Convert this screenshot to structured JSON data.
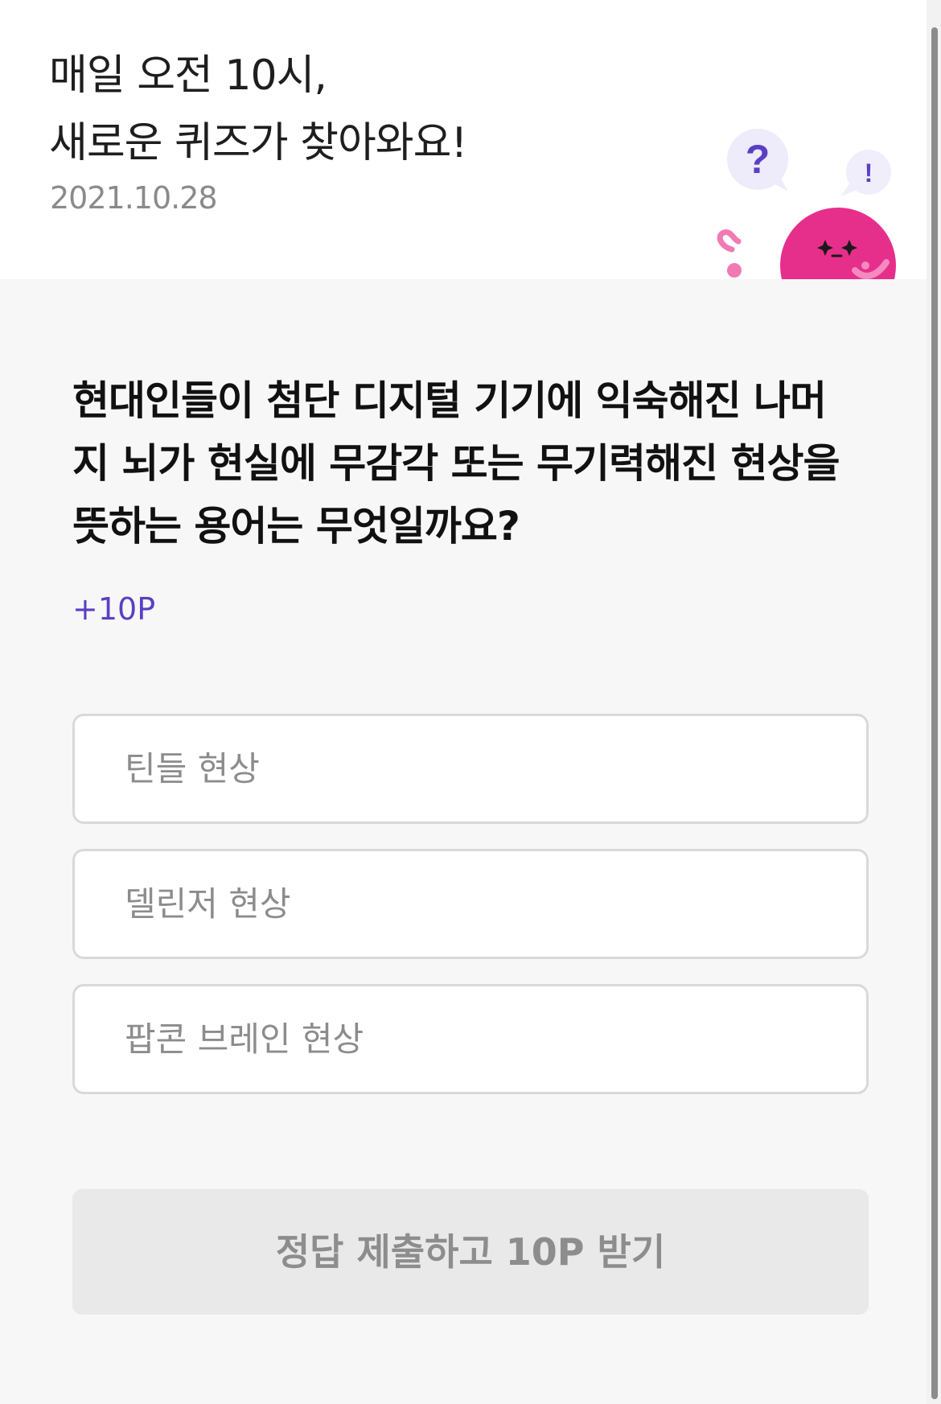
{
  "header": {
    "headline_line1": "매일 오전 10시,",
    "headline_line2": "새로운 퀴즈가 찾아와요!",
    "date": "2021.10.28",
    "mascot": {
      "bubble_left": "?",
      "bubble_right": "!",
      "body_color": "#e62f8a",
      "accent_color": "#5b3fc4"
    }
  },
  "quiz": {
    "question_line1": "현대인들이 첨단 디지털 기기에 익숙해진 나머",
    "question_line2": "지 뇌가 현실에 무감각 또는 무기력해진 현상을",
    "question_line3": "뜻하는 용어는 무엇일까요?",
    "points": "+10P",
    "options": [
      {
        "label": "틴들 현상"
      },
      {
        "label": "델린저 현상"
      },
      {
        "label": "팝콘 브레인 현상"
      }
    ],
    "submit_label": "정답 제출하고 10P 받기"
  },
  "colors": {
    "accent": "#5b3fc4",
    "page_background": "#f7f7f7",
    "header_background": "#ffffff",
    "disabled_button": "#e9e9e9"
  }
}
